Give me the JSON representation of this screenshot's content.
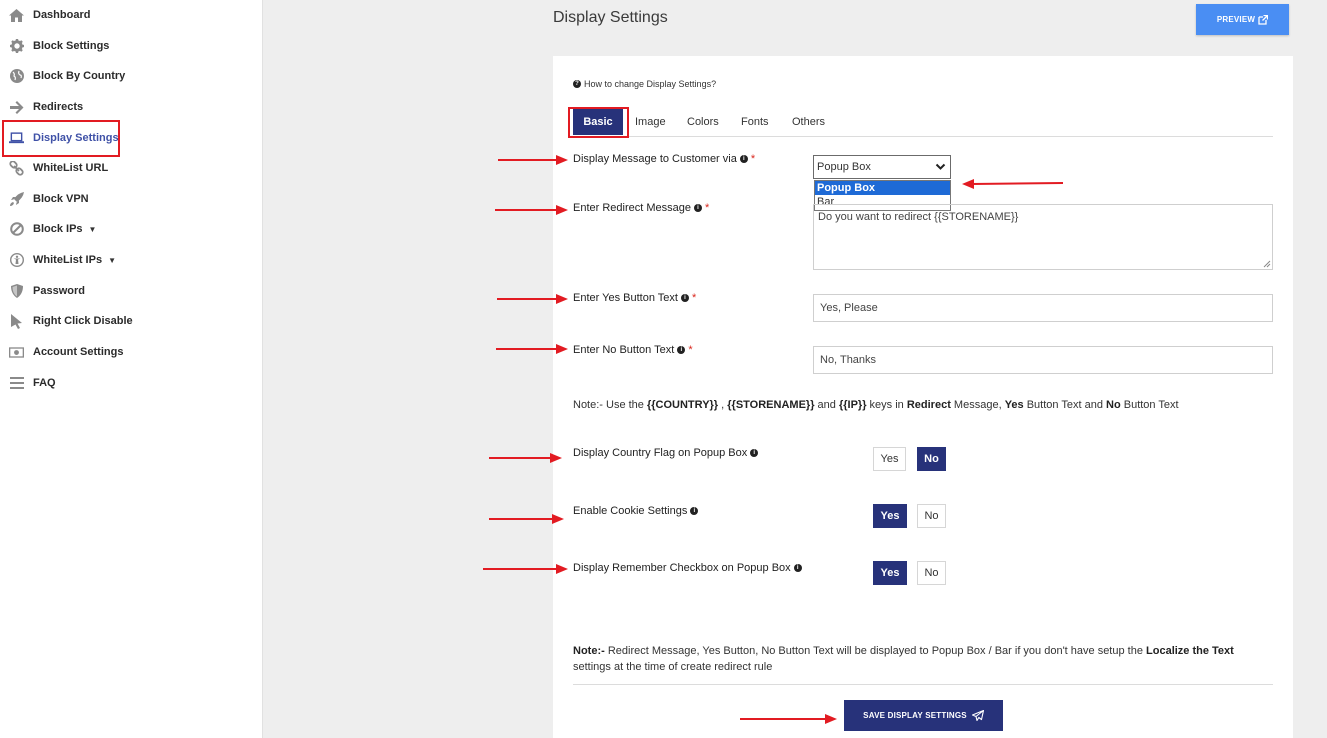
{
  "sidebar": {
    "items": [
      {
        "label": "Dashboard",
        "icon": "home-icon"
      },
      {
        "label": "Block Settings",
        "icon": "gear-icon"
      },
      {
        "label": "Block By Country",
        "icon": "globe-icon"
      },
      {
        "label": "Redirects",
        "icon": "arrow-right-icon"
      },
      {
        "label": "Display Settings",
        "icon": "laptop-icon"
      },
      {
        "label": "WhiteList URL",
        "icon": "link-icon"
      },
      {
        "label": "Block VPN",
        "icon": "rocket-icon"
      },
      {
        "label": "Block IPs",
        "icon": "ban-icon"
      },
      {
        "label": "WhiteList IPs",
        "icon": "universal-access-icon"
      },
      {
        "label": "Password",
        "icon": "shield-icon"
      },
      {
        "label": "Right Click Disable",
        "icon": "cursor-icon"
      },
      {
        "label": "Account Settings",
        "icon": "money-icon"
      },
      {
        "label": "FAQ",
        "icon": "bars-icon"
      }
    ],
    "active": "Display Settings",
    "accent": "#3f51a7"
  },
  "header": {
    "title": "Display Settings",
    "preview_label": "PREVIEW"
  },
  "help_link": "How to change Display Settings?",
  "tabs": [
    {
      "label": "Basic",
      "active": true
    },
    {
      "label": "Image"
    },
    {
      "label": "Colors"
    },
    {
      "label": "Fonts"
    },
    {
      "label": "Others"
    }
  ],
  "form": {
    "display_via": {
      "label": "Display Message to Customer via",
      "value": "Popup Box",
      "options": [
        "Popup Box",
        "Bar"
      ]
    },
    "redirect_message": {
      "label": "Enter Redirect Message",
      "value": "Do you want to redirect {{STORENAME}}"
    },
    "yes_text": {
      "label": "Enter Yes Button Text",
      "value": "Yes, Please"
    },
    "no_text": {
      "label": "Enter No Button Text",
      "value": "No, Thanks"
    },
    "keys_note": {
      "prefix": "Note:- Use the ",
      "key1": "{{COUNTRY}}",
      "sep1": " , ",
      "key2": "{{STORENAME}}",
      "sep2": " and ",
      "key3": "{{IP}}",
      "mid": " keys in ",
      "w1": "Redirect",
      "t1": " Message, ",
      "w2": "Yes",
      "t2": " Button Text and ",
      "w3": "No",
      "t3": " Button Text"
    },
    "country_flag": {
      "label": "Display Country Flag on Popup Box",
      "yes": "Yes",
      "no": "No",
      "selected": "No"
    },
    "cookie": {
      "label": "Enable Cookie Settings",
      "yes": "Yes",
      "no": "No",
      "selected": "Yes"
    },
    "remember": {
      "label": "Display Remember Checkbox on Popup Box",
      "yes": "Yes",
      "no": "No",
      "selected": "Yes"
    },
    "bottom_note": {
      "lead": "Note:-",
      "text1": " Redirect Message, Yes Button, No Button Text will be displayed to Popup Box / Bar if you don't have setup the ",
      "bold": "Localize the Text",
      "text2": " settings at the time of create redirect rule"
    },
    "save_label": "SAVE DISPLAY SETTINGS"
  },
  "colors": {
    "primary": "#27327a",
    "preview": "#4a8ef3",
    "annotation": "#e21b22"
  }
}
